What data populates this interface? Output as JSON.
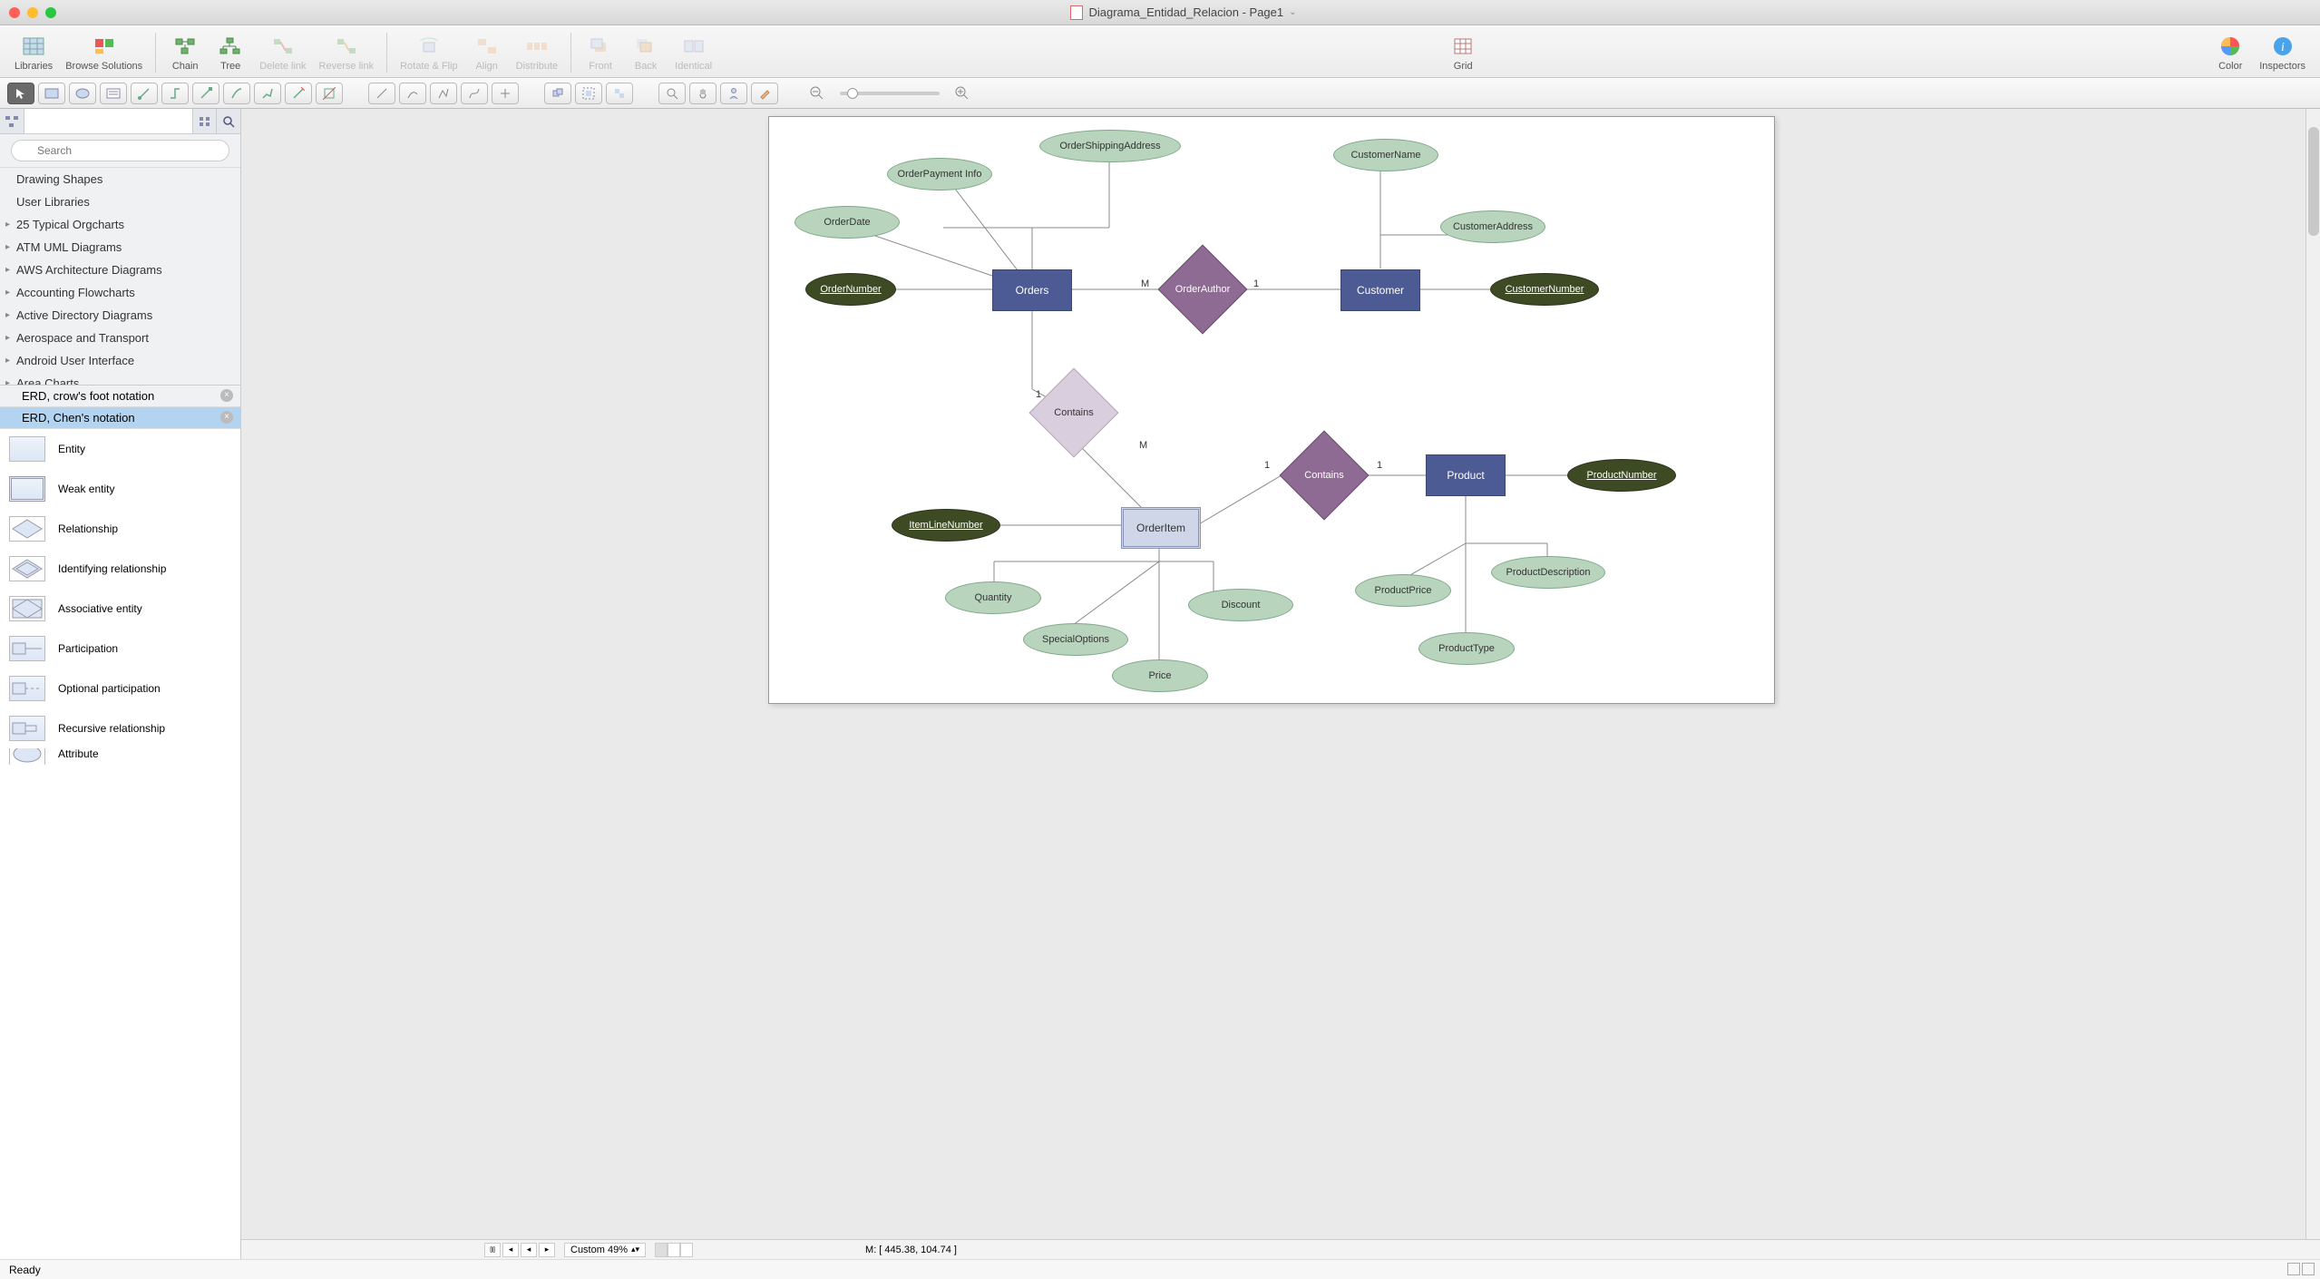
{
  "window": {
    "title": "Diagrama_Entidad_Relacion - Page1"
  },
  "toolbar1": {
    "libraries": "Libraries",
    "browse": "Browse Solutions",
    "chain": "Chain",
    "tree": "Tree",
    "delete_link": "Delete link",
    "reverse_link": "Reverse link",
    "rotate_flip": "Rotate & Flip",
    "align": "Align",
    "distribute": "Distribute",
    "front": "Front",
    "back": "Back",
    "identical": "Identical",
    "grid": "Grid",
    "color": "Color",
    "inspectors": "Inspectors"
  },
  "sidebar": {
    "search_placeholder": "Search",
    "categories": [
      "Drawing Shapes",
      "User Libraries",
      "25 Typical Orgcharts",
      "ATM UML Diagrams",
      "AWS Architecture Diagrams",
      "Accounting Flowcharts",
      "Active Directory Diagrams",
      "Aerospace and Transport",
      "Android User Interface",
      "Area Charts"
    ],
    "stencil_tabs": [
      "ERD, crow's foot notation",
      "ERD, Chen's notation"
    ],
    "shapes": [
      "Entity",
      "Weak entity",
      "Relationship",
      "Identifying relationship",
      "Associative entity",
      "Participation",
      "Optional participation",
      "Recursive relationship",
      "Attribute"
    ]
  },
  "diagram": {
    "entities": {
      "orders": "Orders",
      "customer": "Customer",
      "orderitem": "OrderItem",
      "product": "Product"
    },
    "relations": {
      "orderauthor": "OrderAuthor",
      "contains1": "Contains",
      "contains2": "Contains"
    },
    "attrs": {
      "order_shipping": "OrderShippingAddress",
      "order_payment": "OrderPayment Info",
      "order_date": "OrderDate",
      "customer_name": "CustomerName",
      "customer_address": "CustomerAddress",
      "quantity": "Quantity",
      "special_options": "SpecialOptions",
      "price": "Price",
      "discount": "Discount",
      "product_price": "ProductPrice",
      "product_type": "ProductType",
      "product_desc": "ProductDescription"
    },
    "keys": {
      "order_number": "OrderNumber",
      "customer_number": "CustomerNumber",
      "item_line": "ItemLineNumber",
      "product_number": "ProductNumber"
    },
    "card": {
      "one": "1",
      "many": "M"
    }
  },
  "bottom": {
    "zoom": "Custom 49%",
    "coords": "M: [ 445.38, 104.74 ]",
    "status": "Ready"
  }
}
